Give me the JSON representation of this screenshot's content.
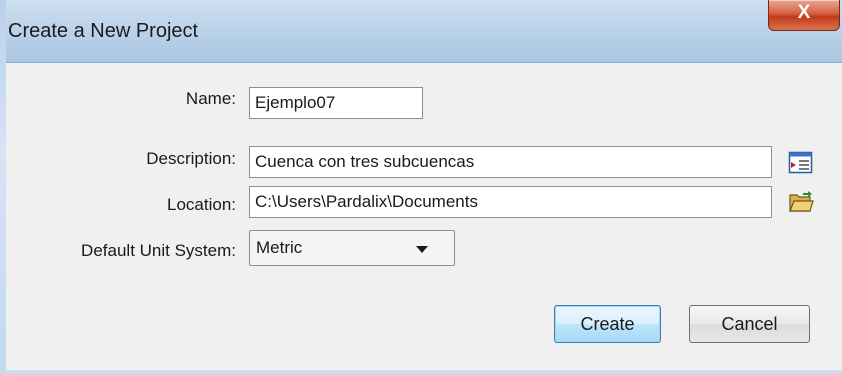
{
  "window": {
    "title": "Create a New Project",
    "close_label": "X"
  },
  "form": {
    "name": {
      "label": "Name:",
      "value": "Ejemplo07"
    },
    "description": {
      "label": "Description:",
      "value": "Cuenca con tres subcuencas",
      "icon": "description-browse-icon"
    },
    "location": {
      "label": "Location:",
      "value": "C:\\Users\\Pardalix\\Documents",
      "icon": "folder-open-icon"
    },
    "unit_system": {
      "label": "Default Unit System:",
      "value": "Metric"
    }
  },
  "buttons": {
    "create": "Create",
    "cancel": "Cancel"
  },
  "colors": {
    "titlebar": "#bcd3ea",
    "panel": "#f0f0f0",
    "close_button": "#c2391a",
    "default_button": "#bee6fd"
  }
}
